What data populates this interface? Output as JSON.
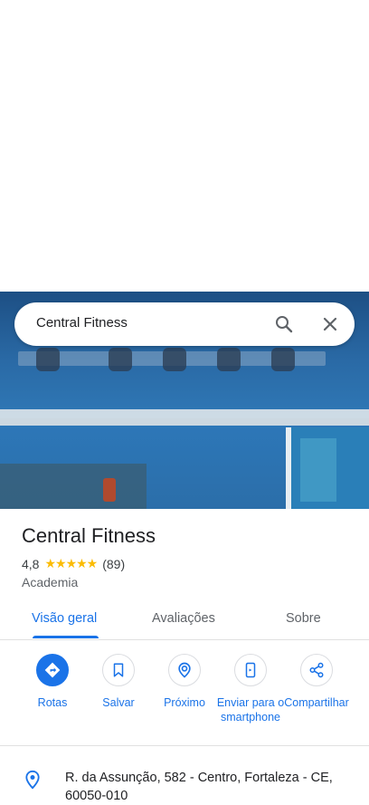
{
  "search": {
    "query": "Central Fitness"
  },
  "place": {
    "name": "Central Fitness",
    "rating": "4,8",
    "stars": "★★★★★",
    "review_count": "(89)",
    "category": "Academia"
  },
  "tabs": [
    {
      "label": "Visão geral",
      "active": true
    },
    {
      "label": "Avaliações",
      "active": false
    },
    {
      "label": "Sobre",
      "active": false
    }
  ],
  "actions": [
    {
      "label": "Rotas",
      "icon": "directions-icon"
    },
    {
      "label": "Salvar",
      "icon": "bookmark-icon"
    },
    {
      "label": "Próximo",
      "icon": "nearby-icon"
    },
    {
      "label": "Enviar para o smartphone",
      "icon": "send-to-phone-icon"
    },
    {
      "label": "Compartilhar",
      "icon": "share-icon"
    }
  ],
  "address": "R. da Assunção, 582 - Centro, Fortaleza - CE, 60050-010",
  "colors": {
    "accent": "#1a73e8",
    "star": "#fbbc04"
  }
}
